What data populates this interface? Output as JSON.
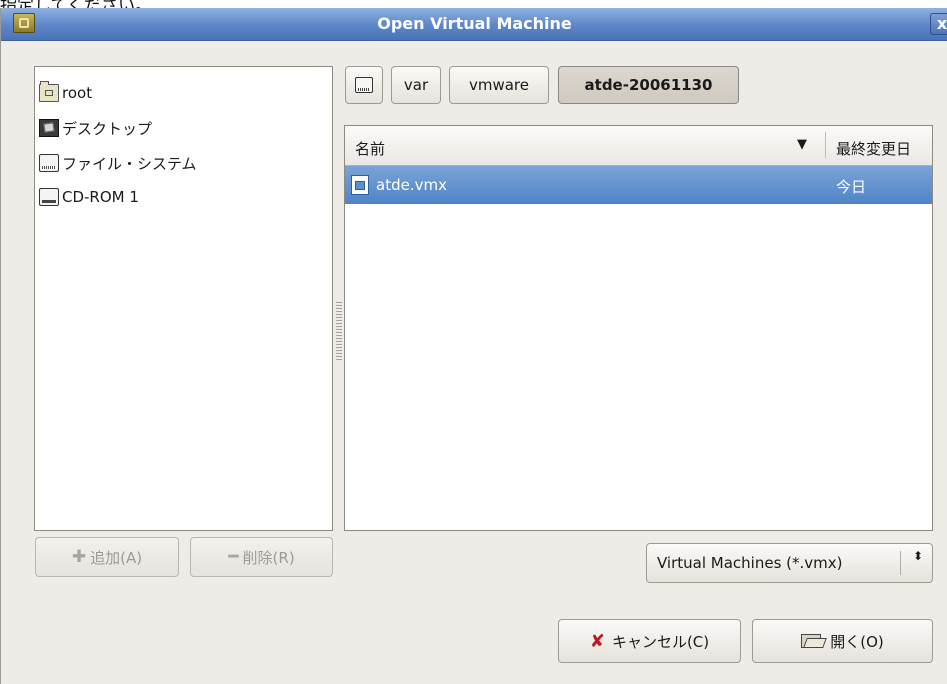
{
  "top_text": "指定してください。",
  "window": {
    "title": "Open Virtual Machine",
    "close_label": "x"
  },
  "places": {
    "items": [
      {
        "label": "root",
        "icon": "home-folder-icon"
      },
      {
        "label": "デスクトップ",
        "icon": "desktop-icon"
      },
      {
        "label": "ファイル・システム",
        "icon": "filesystem-drive-icon"
      },
      {
        "label": "CD-ROM 1",
        "icon": "cdrom-icon"
      }
    ],
    "add_label": "追加(A)",
    "remove_label": "削除(R)"
  },
  "pathbar": {
    "segments": [
      {
        "label": "",
        "icon": "drive-icon"
      },
      {
        "label": "var"
      },
      {
        "label": "vmware"
      },
      {
        "label": "atde-20061130",
        "active": true
      }
    ]
  },
  "filelist": {
    "columns": {
      "name": "名前",
      "modified": "最終変更日"
    },
    "sort_indicator": "▼",
    "rows": [
      {
        "name": "atde.vmx",
        "modified": "今日",
        "selected": true
      }
    ]
  },
  "filter": {
    "selected": "Virtual Machines (*.vmx)",
    "arrows": "⬍"
  },
  "actions": {
    "cancel_label": "キャンセル(C)",
    "open_label": "開く(O)"
  },
  "colors": {
    "titlebar": "#5c86c8",
    "selection": "#4f84c9",
    "dialog_bg": "#efebe7",
    "cancel_icon": "#c0161e"
  }
}
